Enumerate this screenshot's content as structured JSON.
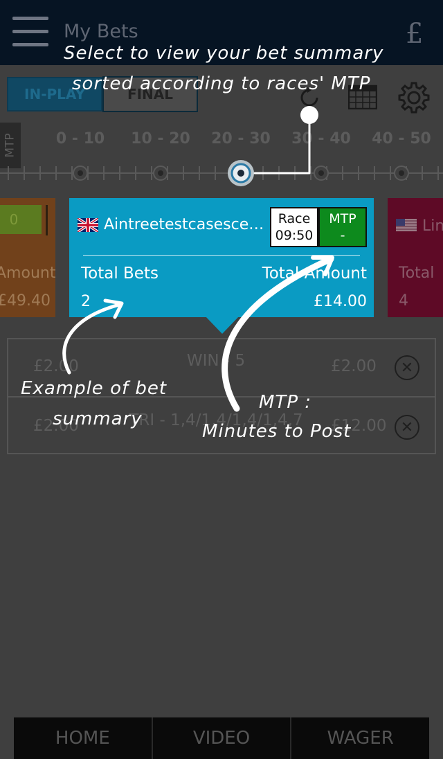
{
  "header": {
    "title": "My Bets",
    "currency_icon": "£"
  },
  "tabs": {
    "in_play": "IN-PLAY",
    "final": "FINAL"
  },
  "mtp_bar": {
    "label": "MTP",
    "ranges": [
      "0 - 10",
      "10 - 20",
      "20 - 30",
      "30 - 40",
      "40 - 50"
    ],
    "selected_range": "20 - 30"
  },
  "cards": {
    "left": {
      "button": "0",
      "amount_label": "Amount :",
      "amount_value": "£49.40"
    },
    "main": {
      "country_flag": "uk-flag-icon",
      "race_name": "Aintreetestcasescenario",
      "race_label": "Race",
      "race_time": "09:50",
      "mtp_label": "MTP",
      "mtp_value": "-",
      "total_bets_label": "Total Bets",
      "total_bets_value": "2",
      "total_amount_label": "Total Amount",
      "total_amount_value": "£14.00"
    },
    "right": {
      "country_flag": "us-flag-icon",
      "race_name": "Lin",
      "total_label": "Total",
      "total_value": "4"
    }
  },
  "bets": [
    {
      "stake": "£2.00",
      "description": "WIN - 5",
      "amount": "£2.00"
    },
    {
      "stake": "£2.00",
      "description": "TRI - 1,4/1,4/1,4/1,4,7",
      "amount": "£12.00"
    }
  ],
  "bottom_nav": {
    "home": "HOME",
    "video": "VIDEO",
    "wager": "WAGER"
  },
  "annotations": {
    "select_line1": "Select to view your bet summary",
    "select_line2": "sorted according to races' MTP",
    "example_line1": "Example of bet",
    "example_line2": "summary",
    "mtp_line1": "MTP :",
    "mtp_line2": "Minutes to Post"
  },
  "colors": {
    "header_bg": "#061423",
    "card_main": "#0a9bc3",
    "card_left": "#71411b",
    "card_right": "#5e0a26",
    "mtp_box": "#0d8a1d",
    "overlay_bg": "#3f3f3f"
  }
}
